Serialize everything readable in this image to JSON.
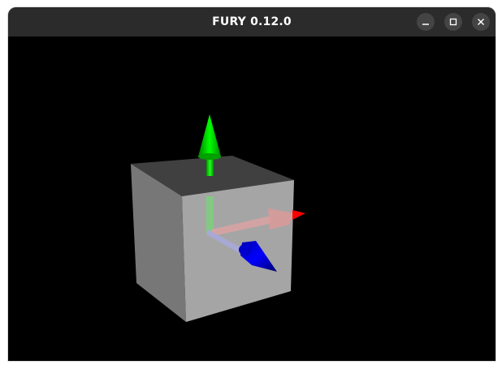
{
  "window": {
    "title": "FURY 0.12.0"
  },
  "controls": {
    "minimize_icon": "minimize-icon",
    "maximize_icon": "maximize-icon",
    "close_icon": "close-icon"
  },
  "scene": {
    "background": "#000000",
    "cube_colors": {
      "top": "#404040",
      "left": "#777777",
      "front": "#a5a5a5"
    },
    "axis_colors": {
      "x": "#ff0000",
      "y": "#00ff00",
      "z": "#0000ff"
    }
  }
}
